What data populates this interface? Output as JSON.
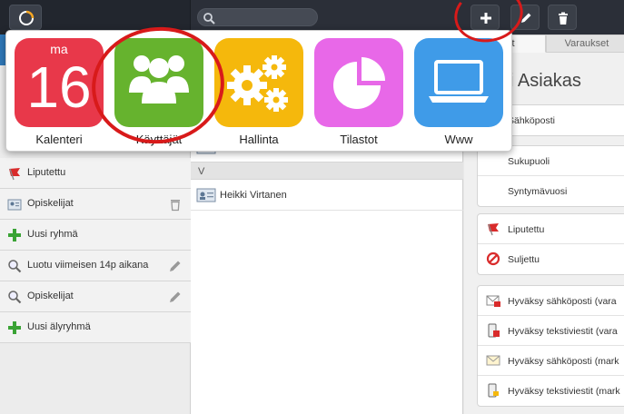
{
  "topbar": {
    "logo_icon": "app-logo-icon",
    "search_placeholder": "",
    "buttons": [
      "plus-icon",
      "pencil-icon",
      "trash-icon"
    ]
  },
  "launcher": {
    "apps": [
      {
        "name": "Kalenteri",
        "icon": "calendar-icon",
        "color": "#e8384a",
        "weekday": "ma",
        "day": "16"
      },
      {
        "name": "Käyttäjät",
        "icon": "users-icon",
        "color": "#66b32e"
      },
      {
        "name": "Hallinta",
        "icon": "gears-icon",
        "color": "#f5b80c"
      },
      {
        "name": "Tilastot",
        "icon": "pie-chart-icon",
        "color": "#e868e8"
      },
      {
        "name": "Www",
        "icon": "laptop-icon",
        "color": "#3f9be8"
      }
    ]
  },
  "sidebar": {
    "items": [
      {
        "label": "Liputettu",
        "icon": "flag-icon"
      },
      {
        "label": "Opiskelijat",
        "icon": "contact-card-icon",
        "action": "trash-icon"
      },
      {
        "label": "Uusi ryhmä",
        "icon": "plus-icon"
      },
      {
        "label": "Luotu viimeisen 14p aikana",
        "icon": "magnifier-icon",
        "action": "pencil-icon"
      },
      {
        "label": "Opiskelijat",
        "icon": "magnifier-icon",
        "action": "pencil-icon"
      },
      {
        "label": "Uusi älyryhmä",
        "icon": "plus-icon"
      }
    ]
  },
  "middle": {
    "group_letter": "V",
    "rows": [
      {
        "label": "Heikki Virtanen",
        "icon": "contact-card-icon"
      }
    ]
  },
  "right": {
    "tabs": [
      "st",
      "Varaukset"
    ],
    "title": "si Asiakas",
    "group1": [
      "Sähköposti"
    ],
    "group2": [
      "Sukupuoli",
      "Syntymävuosi"
    ],
    "group3": [
      {
        "label": "Liputettu",
        "icon": "flag-icon"
      },
      {
        "label": "Suljettu",
        "icon": "blocked-icon"
      }
    ],
    "group4": [
      {
        "label": "Hyväksy sähköposti (vara",
        "icon": "email-calendar-icon"
      },
      {
        "label": "Hyväksy tekstiviestit (vara",
        "icon": "phone-calendar-icon"
      },
      {
        "label": "Hyväksy sähköposti (mark",
        "icon": "email-icon"
      },
      {
        "label": "Hyväksy tekstiviestit (mark",
        "icon": "phone-icon"
      }
    ]
  }
}
